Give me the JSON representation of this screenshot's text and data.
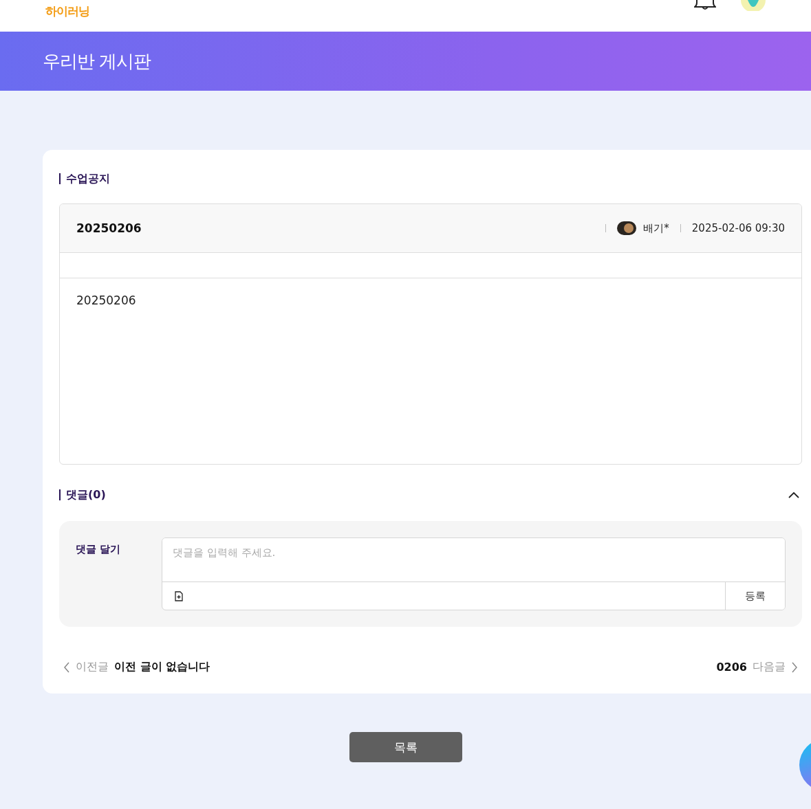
{
  "header": {
    "logo": "하이러닝"
  },
  "banner": {
    "title": "우리반 게시판"
  },
  "board": {
    "section_title": "수업공지",
    "post": {
      "title": "20250206",
      "author": "배기*",
      "date": "2025-02-06 09:30",
      "body": "20250206"
    },
    "comments": {
      "title": "댓글(0)",
      "expanded": true,
      "form_label": "댓글 달기",
      "placeholder": "댓글을 입력해 주세요.",
      "submit": "등록"
    },
    "nav": {
      "prev_label": "이전글",
      "prev_title": "이전 글이 없습니다",
      "next_title": "0206",
      "next_label": "다음글"
    }
  },
  "list_button": "목록"
}
